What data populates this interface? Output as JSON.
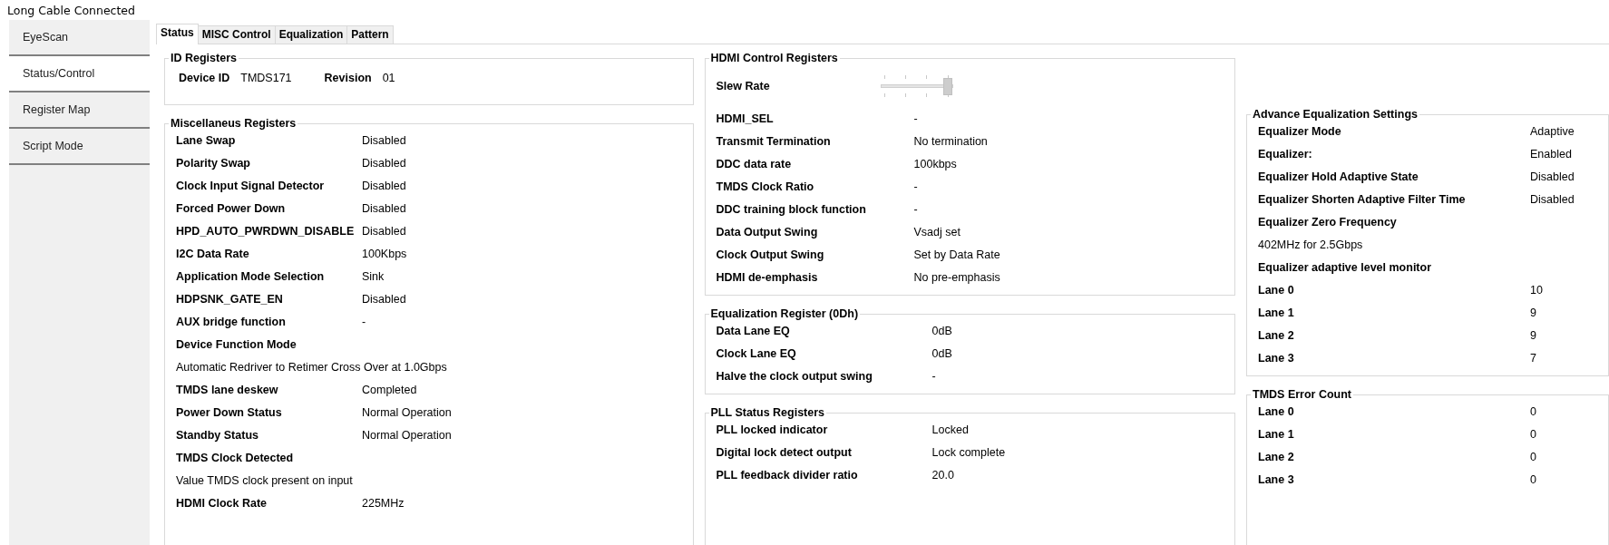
{
  "window": {
    "title": "Long Cable Connected"
  },
  "sidebar": {
    "items": [
      {
        "label": "EyeScan",
        "selected": false
      },
      {
        "label": "Status/Control",
        "selected": true
      },
      {
        "label": "Register Map",
        "selected": false
      },
      {
        "label": "Script Mode",
        "selected": false
      }
    ]
  },
  "tabs": [
    {
      "label": "Status",
      "selected": true
    },
    {
      "label": "MISC Control",
      "selected": false
    },
    {
      "label": "Equalization",
      "selected": false
    },
    {
      "label": "Pattern",
      "selected": false
    }
  ],
  "columns": [
    {
      "groups": [
        {
          "title": "ID Registers",
          "kind": "inline",
          "rows": [
            {
              "label": "Device ID",
              "value": "TMDS171"
            },
            {
              "label": "Revision",
              "value": "01"
            }
          ]
        },
        {
          "title": "Miscellaneus Registers",
          "kind": "list",
          "rows": [
            {
              "kind": "pair",
              "label": "Lane Swap",
              "value": "Disabled"
            },
            {
              "kind": "pair",
              "label": "Polarity Swap",
              "value": "Disabled"
            },
            {
              "kind": "pair",
              "label": "Clock Input Signal Detector",
              "value": "Disabled"
            },
            {
              "kind": "pair",
              "label": "Forced Power Down",
              "value": "Disabled"
            },
            {
              "kind": "pair",
              "label": "HPD_AUTO_PWRDWN_DISABLE",
              "value": "Disabled"
            },
            {
              "kind": "pair",
              "label": "I2C Data Rate",
              "value": "100Kbps"
            },
            {
              "kind": "pair",
              "label": "Application Mode Selection",
              "value": "Sink"
            },
            {
              "kind": "pair",
              "label": "HDPSNK_GATE_EN",
              "value": "Disabled"
            },
            {
              "kind": "pair",
              "label": "AUX bridge function",
              "value": "-"
            },
            {
              "kind": "heading",
              "label": "Device Function Mode"
            },
            {
              "kind": "text",
              "label": "Automatic Redriver to Retimer Cross Over at 1.0Gbps"
            },
            {
              "kind": "pair",
              "label": "TMDS lane deskew",
              "value": "Completed"
            },
            {
              "kind": "pair",
              "label": "Power Down Status",
              "value": "Normal Operation"
            },
            {
              "kind": "pair",
              "label": "Standby Status",
              "value": "Normal Operation"
            },
            {
              "kind": "heading",
              "label": "TMDS Clock Detected"
            },
            {
              "kind": "text",
              "label": "Value TMDS clock present on input"
            },
            {
              "kind": "pair",
              "label": "HDMI Clock Rate",
              "value": "225MHz"
            }
          ]
        }
      ]
    },
    {
      "groups": [
        {
          "title": "HDMI Control Registers",
          "kind": "list",
          "rows": [
            {
              "kind": "slider",
              "label": "Slew Rate",
              "level": 1.0
            },
            {
              "kind": "pair",
              "label": "HDMI_SEL",
              "value": "-"
            },
            {
              "kind": "pair",
              "label": "Transmit Termination",
              "value": "No termination"
            },
            {
              "kind": "pair",
              "label": "DDC data rate",
              "value": "100kbps"
            },
            {
              "kind": "pair",
              "label": "TMDS Clock Ratio",
              "value": "-"
            },
            {
              "kind": "pair",
              "label": "DDC training block function",
              "value": "-"
            },
            {
              "kind": "pair",
              "label": "Data Output Swing",
              "value": "Vsadj set"
            },
            {
              "kind": "pair",
              "label": "Clock Output Swing",
              "value": "Set by Data Rate"
            },
            {
              "kind": "pair",
              "label": "HDMI de-emphasis",
              "value": "No pre-emphasis"
            }
          ]
        },
        {
          "title": "Equalization Register (0Dh)",
          "kind": "list",
          "rows": [
            {
              "kind": "pair",
              "label": "Data Lane EQ",
              "value": "0dB"
            },
            {
              "kind": "pair",
              "label": "Clock Lane EQ",
              "value": "0dB"
            },
            {
              "kind": "pair",
              "label": "Halve the clock output swing",
              "value": "-"
            }
          ]
        },
        {
          "title": "PLL Status Registers",
          "kind": "list",
          "rows": [
            {
              "kind": "pair",
              "label": "PLL locked indicator",
              "value": "Locked"
            },
            {
              "kind": "pair",
              "label": "Digital lock detect output",
              "value": "Lock complete"
            },
            {
              "kind": "pair",
              "label": "PLL feedback divider ratio",
              "value": "20.0"
            }
          ]
        }
      ]
    },
    {
      "groups": [
        {
          "title": "Advance  Equalization Settings",
          "kind": "list",
          "rows": [
            {
              "kind": "pair",
              "label": "Equalizer Mode",
              "value": "Adaptive"
            },
            {
              "kind": "pair",
              "label": "Equalizer:",
              "value": "Enabled"
            },
            {
              "kind": "pair",
              "label": "Equalizer Hold Adaptive State",
              "value": "Disabled"
            },
            {
              "kind": "pair",
              "label": "Equalizer Shorten Adaptive Filter Time",
              "value": "Disabled"
            },
            {
              "kind": "heading",
              "label": "Equalizer Zero Frequency"
            },
            {
              "kind": "text",
              "label": "402MHz for 2.5Gbps"
            },
            {
              "kind": "heading",
              "label": "Equalizer adaptive level monitor"
            },
            {
              "kind": "pair",
              "label": "Lane 0",
              "value": "10"
            },
            {
              "kind": "pair",
              "label": "Lane 1",
              "value": "9"
            },
            {
              "kind": "pair",
              "label": "Lane 2",
              "value": "9"
            },
            {
              "kind": "pair",
              "label": "Lane 3",
              "value": "7"
            }
          ]
        },
        {
          "title": "TMDS Error Count",
          "kind": "list",
          "rows": [
            {
              "kind": "pair",
              "label": "Lane 0",
              "value": "0"
            },
            {
              "kind": "pair",
              "label": "Lane 1",
              "value": "0"
            },
            {
              "kind": "pair",
              "label": "Lane 2",
              "value": "0"
            },
            {
              "kind": "pair",
              "label": "Lane 3",
              "value": "0"
            }
          ]
        }
      ]
    }
  ]
}
